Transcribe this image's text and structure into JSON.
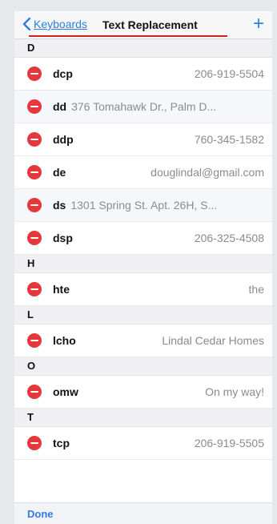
{
  "nav": {
    "back_label": "Keyboards",
    "title": "Text Replacement",
    "add_symbol": "+"
  },
  "sections": [
    {
      "letter": "D",
      "items": [
        {
          "shortcut": "dcp",
          "phrase": "206-919-5504"
        },
        {
          "shortcut": "dd",
          "phrase": "376 Tomahawk Dr., Palm D..."
        },
        {
          "shortcut": "ddp",
          "phrase": "760-345-1582"
        },
        {
          "shortcut": "de",
          "phrase": "douglindal@gmail.com"
        },
        {
          "shortcut": "ds",
          "phrase": "1301 Spring St. Apt. 26H, S..."
        },
        {
          "shortcut": "dsp",
          "phrase": "206-325-4508"
        }
      ]
    },
    {
      "letter": "H",
      "items": [
        {
          "shortcut": "hte",
          "phrase": "the"
        }
      ]
    },
    {
      "letter": "L",
      "items": [
        {
          "shortcut": "lcho",
          "phrase": "Lindal Cedar Homes"
        }
      ]
    },
    {
      "letter": "O",
      "items": [
        {
          "shortcut": "omw",
          "phrase": "On my way!"
        }
      ]
    },
    {
      "letter": "T",
      "items": [
        {
          "shortcut": "tcp",
          "phrase": "206-919-5505"
        }
      ]
    }
  ],
  "toolbar": {
    "done_label": "Done"
  },
  "colors": {
    "accent": "#2f7de1",
    "delete": "#e4383c",
    "annotation_underline": "#d0201a"
  }
}
